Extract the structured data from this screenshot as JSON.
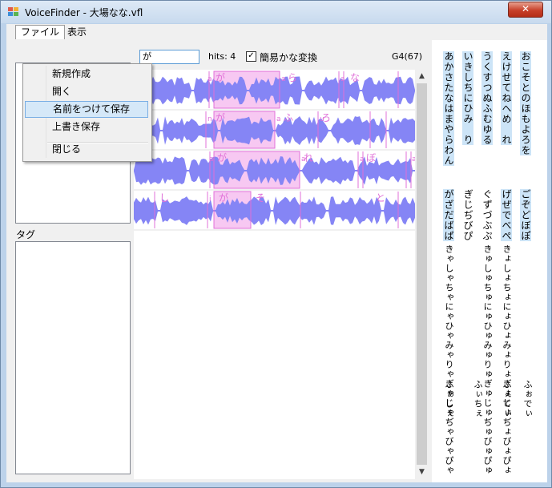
{
  "window": {
    "title": "VoiceFinder - 大場なな.vfl",
    "close_label": "✕"
  },
  "menu": {
    "items": [
      "ファイル",
      "表示"
    ],
    "file_dropdown": [
      "新規作成",
      "開く",
      "名前をつけて保存",
      "上書き保存",
      "閉じる"
    ],
    "highlighted": "名前をつけて保存"
  },
  "left": {
    "tag_label": "タグ"
  },
  "search": {
    "value": "が",
    "hits": "hits: 4",
    "kana_label": "簡易かな変換",
    "kana_checked": true,
    "count": "G4(67)"
  },
  "waveform": {
    "color": "#8585f5",
    "highlight_color": "#f7c8f2",
    "rows": [
      {
        "labels": [
          "a",
          "が",
          "a",
          "ら",
          "a",
          "な"
        ]
      },
      {
        "labels": [
          "n",
          "が",
          "a",
          "ふ",
          "u",
          "ろ"
        ]
      },
      {
        "labels": [
          "a",
          "が",
          "a",
          "れ",
          "a",
          "ぼ",
          "a"
        ]
      },
      {
        "labels": [
          "し",
          "i",
          "が",
          "そ",
          "と"
        ]
      }
    ]
  },
  "kana_grid": {
    "columns": [
      {
        "text": "おこそとのほもよろを",
        "highlight": true
      },
      {
        "text": "えけせてねへめ　れ",
        "highlight": true
      },
      {
        "text": "うくすつぬふむゆる",
        "highlight": true
      },
      {
        "text": "いきしちにひみ　り",
        "highlight": true
      },
      {
        "text": "あかさたなはまやらわん",
        "highlight": true
      },
      {
        "text": "ごぞどぼぽ",
        "highlight": true
      },
      {
        "text": "げぜでべぺ",
        "highlight": true
      },
      {
        "text": "ぐずづぶぷ",
        "highlight": false
      },
      {
        "text": "ぎじぢびぴ",
        "highlight": false
      },
      {
        "text": "がざだばぱ",
        "highlight": true
      },
      {
        "text": "きょしょちょにょひょみょりょぎょじょぢょびょぴょ",
        "highlight": false
      },
      {
        "text": "きゅしゅちゅにゅひゅみゅりゅぎゅじゅぢゅびゅぴゅ",
        "highlight": false
      },
      {
        "text": "きゃしゃちゃにゃひゃみゃりゃぎゃじゃぢゃびゃぴゃ",
        "highlight": false
      },
      {
        "text": "ふぉでぃ",
        "highlight": false
      },
      {
        "text": "ふぇてぃ",
        "highlight": false
      },
      {
        "text": "ふぃちぇ",
        "highlight": false
      },
      {
        "text": "ふぁしぇ",
        "highlight": false
      }
    ]
  }
}
